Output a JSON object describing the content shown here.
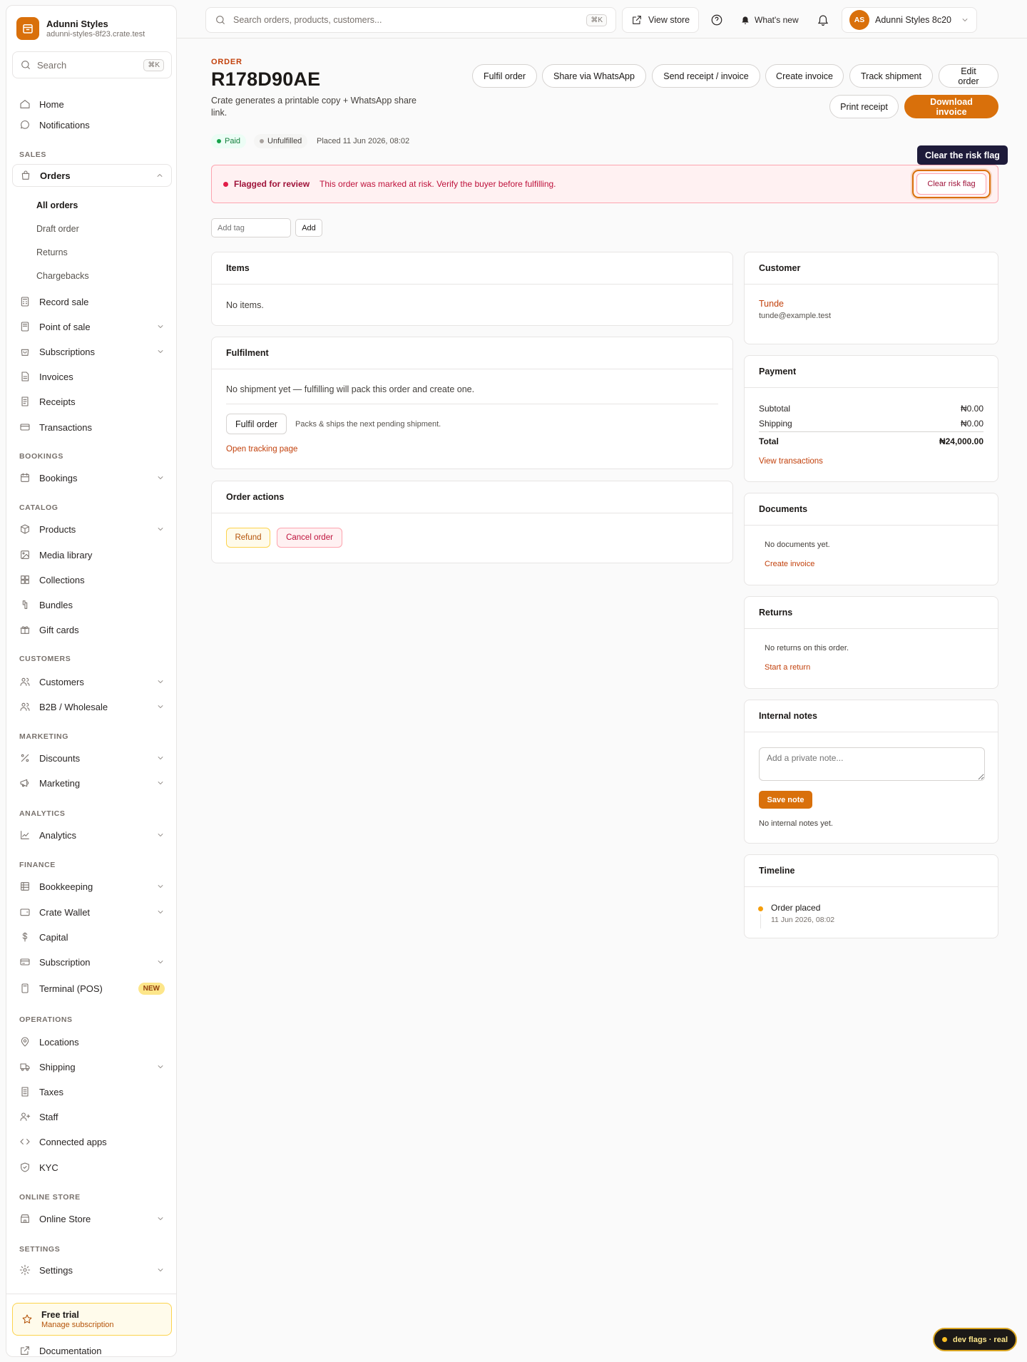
{
  "store": {
    "name": "Adunni Styles",
    "domain": "adunni-styles-8f23.crate.test"
  },
  "sidebar": {
    "search_label": "Search",
    "search_kbd": "⌘K",
    "home": "Home",
    "notifications": "Notifications",
    "sections": {
      "sales": "SALES",
      "bookings": "BOOKINGS",
      "catalog": "CATALOG",
      "customers": "CUSTOMERS",
      "marketing": "MARKETING",
      "analytics": "ANALYTICS",
      "finance": "FINANCE",
      "operations": "OPERATIONS",
      "online_store": "ONLINE STORE",
      "settings": "SETTINGS"
    },
    "orders": "Orders",
    "orders_sub": [
      "All orders",
      "Draft order",
      "Returns",
      "Chargebacks"
    ],
    "record_sale": "Record sale",
    "point_of_sale": "Point of sale",
    "subscriptions": "Subscriptions",
    "invoices": "Invoices",
    "receipts": "Receipts",
    "transactions": "Transactions",
    "bookings": "Bookings",
    "products": "Products",
    "media_library": "Media library",
    "collections": "Collections",
    "bundles": "Bundles",
    "gift_cards": "Gift cards",
    "customers": "Customers",
    "b2b": "B2B / Wholesale",
    "discounts": "Discounts",
    "marketing": "Marketing",
    "analytics": "Analytics",
    "bookkeeping": "Bookkeeping",
    "crate_wallet": "Crate Wallet",
    "capital": "Capital",
    "subscription": "Subscription",
    "terminal": "Terminal (POS)",
    "new_badge": "NEW",
    "locations": "Locations",
    "shipping": "Shipping",
    "taxes": "Taxes",
    "staff": "Staff",
    "connected_apps": "Connected apps",
    "kyc": "KYC",
    "online_store": "Online Store",
    "settings": "Settings",
    "trial_title": "Free trial",
    "trial_sub": "Manage subscription",
    "documentation": "Documentation"
  },
  "topbar": {
    "search_placeholder": "Search orders, products, customers...",
    "search_kbd": "⌘K",
    "view_store": "View store",
    "whats_new": "What's new",
    "account_initials": "AS",
    "account_name": "Adunni Styles 8c20"
  },
  "order": {
    "label": "ORDER",
    "id": "R178D90AE",
    "description": "Crate generates a printable copy + WhatsApp share link.",
    "status_paid": "Paid",
    "status_fulfil": "Unfulfilled",
    "placed": "Placed 11 Jun 2026, 08:02"
  },
  "actions": {
    "fulfil": "Fulfil order",
    "whatsapp": "Share via WhatsApp",
    "send_receipt": "Send receipt / invoice",
    "create_invoice": "Create invoice",
    "track": "Track shipment",
    "edit": "Edit order",
    "print_receipt": "Print receipt",
    "download_invoice": "Download invoice"
  },
  "risk": {
    "title": "Flagged for review",
    "message": "This order was marked at risk. Verify the buyer before fulfilling.",
    "button": "Clear risk flag",
    "tooltip": "Clear the risk flag"
  },
  "tags": {
    "placeholder": "Add tag",
    "add": "Add"
  },
  "items": {
    "title": "Items",
    "empty": "No items."
  },
  "fulfilment": {
    "title": "Fulfilment",
    "message": "No shipment yet — fulfilling will pack this order and create one.",
    "button": "Fulfil order",
    "hint": "Packs & ships the next pending shipment.",
    "tracking_link": "Open tracking page"
  },
  "order_actions": {
    "title": "Order actions",
    "refund": "Refund",
    "cancel": "Cancel order"
  },
  "customer": {
    "title": "Customer",
    "name": "Tunde",
    "email": "tunde@example.test"
  },
  "payment": {
    "title": "Payment",
    "subtotal_label": "Subtotal",
    "subtotal": "₦0.00",
    "shipping_label": "Shipping",
    "shipping": "₦0.00",
    "total_label": "Total",
    "total": "₦24,000.00",
    "link": "View transactions"
  },
  "documents": {
    "title": "Documents",
    "empty": "No documents yet.",
    "link": "Create invoice"
  },
  "returns": {
    "title": "Returns",
    "empty": "No returns on this order.",
    "link": "Start a return"
  },
  "notes": {
    "title": "Internal notes",
    "placeholder": "Add a private note...",
    "save": "Save note",
    "empty": "No internal notes yet."
  },
  "timeline": {
    "title": "Timeline",
    "event": "Order placed",
    "time": "11 Jun 2026, 08:02"
  },
  "devflags": "dev flags · real",
  "colors": {
    "accent": "#d9700b",
    "risk": "#e11d48",
    "paid": "#16a34a"
  }
}
